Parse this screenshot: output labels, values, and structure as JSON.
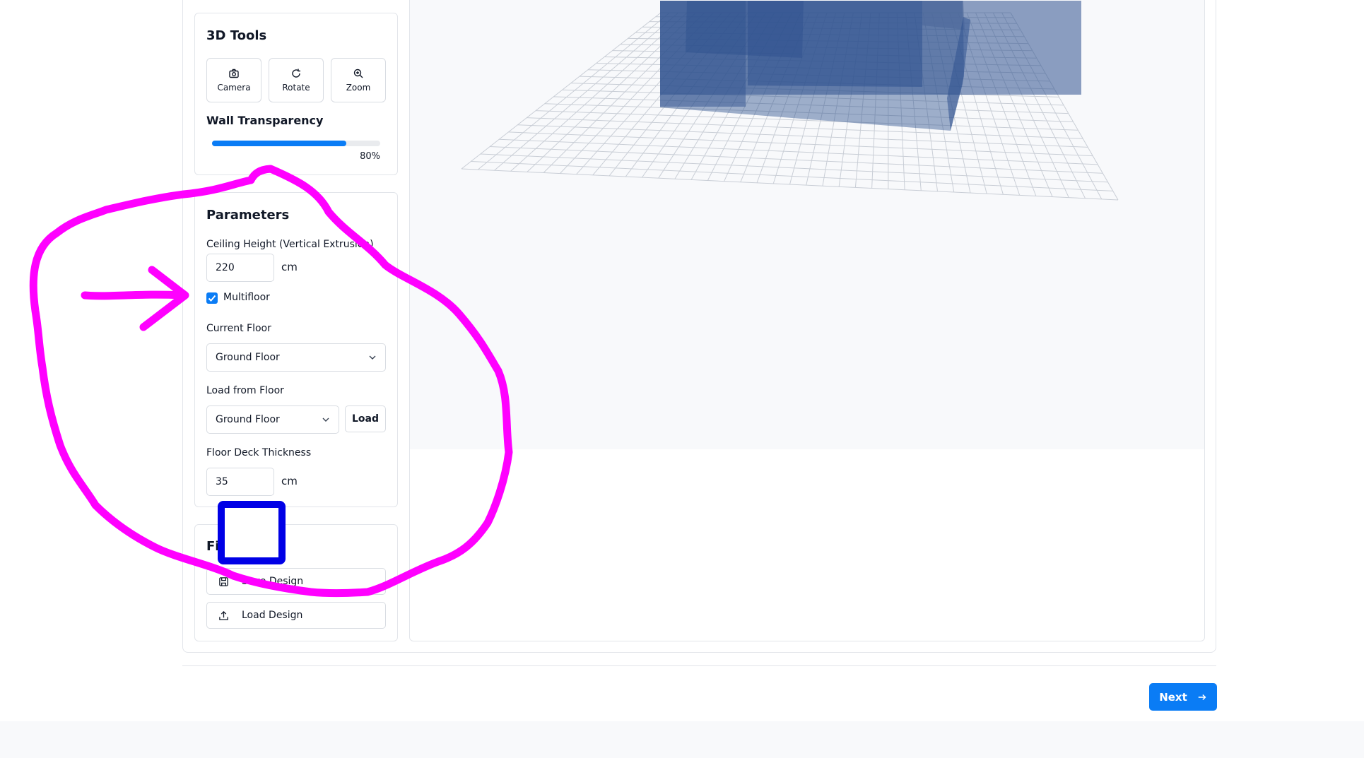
{
  "tools_panel": {
    "title": "3D Tools",
    "buttons": [
      {
        "label": "Camera",
        "icon": "camera-icon"
      },
      {
        "label": "Rotate",
        "icon": "rotate-icon"
      },
      {
        "label": "Zoom",
        "icon": "zoom-icon"
      }
    ],
    "transparency": {
      "label": "Wall Transparency",
      "value": 80,
      "value_text": "80%"
    }
  },
  "parameters_panel": {
    "title": "Parameters",
    "ceiling_height": {
      "label": "Ceiling Height (Vertical Extrusion)",
      "value": "220",
      "unit": "cm"
    },
    "multifloor": {
      "label": "Multifloor",
      "checked": true
    },
    "current_floor": {
      "label": "Current Floor",
      "selected": "Ground Floor"
    },
    "load_from_floor": {
      "label": "Load from Floor",
      "selected": "Ground Floor",
      "button": "Load"
    },
    "floor_deck": {
      "label": "Floor Deck Thickness",
      "value": "35",
      "unit": "cm"
    }
  },
  "files_panel": {
    "title": "Files",
    "save_label": "Save Design",
    "load_label": "Load Design"
  },
  "footer": {
    "next_label": "Next"
  },
  "colors": {
    "accent": "#0a7cf5",
    "annotation_magenta": "#ff00ff",
    "annotation_blue": "#0000e6",
    "wall_blue": "#2f528f"
  }
}
